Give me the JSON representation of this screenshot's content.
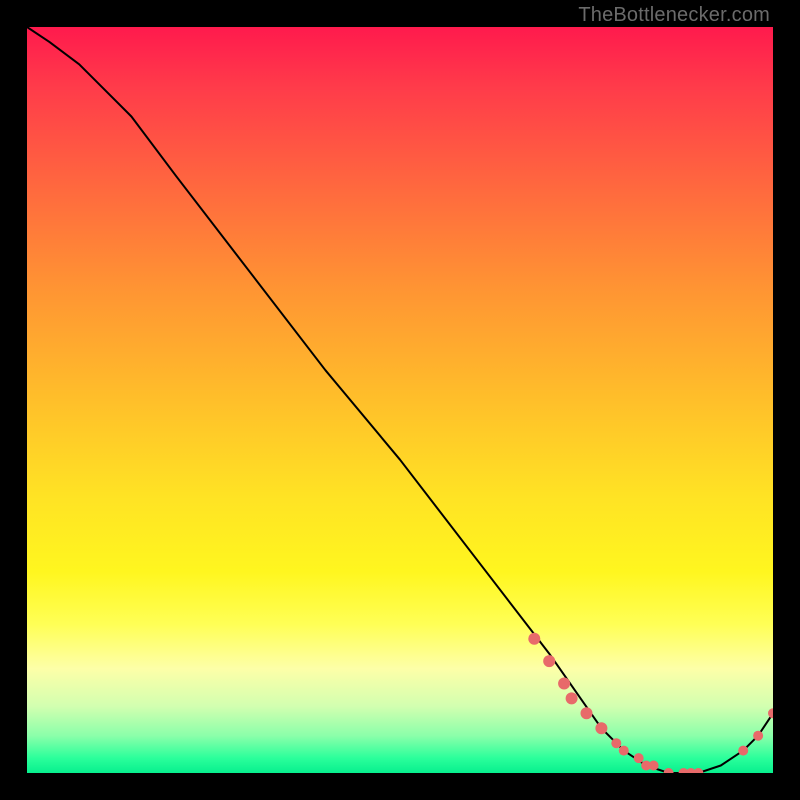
{
  "watermark": "TheBottlenecker.com",
  "colors": {
    "gradient_top": "#ff1a4d",
    "gradient_mid": "#ffe324",
    "gradient_bottom": "#07f08e",
    "curve": "#000000",
    "points": "#e86a6a",
    "page_bg": "#000000"
  },
  "chart_data": {
    "type": "line",
    "title": "",
    "xlabel": "",
    "ylabel": "",
    "xlim": [
      0,
      100
    ],
    "ylim": [
      0,
      100
    ],
    "grid": false,
    "legend": false,
    "curve": {
      "x": [
        0,
        3,
        7,
        10,
        14,
        20,
        30,
        40,
        50,
        60,
        70,
        77,
        80,
        83,
        86,
        90,
        93,
        96,
        98,
        100
      ],
      "y": [
        100,
        98,
        95,
        92,
        88,
        80,
        67,
        54,
        42,
        29,
        16,
        6,
        3,
        1,
        0,
        0,
        1,
        3,
        5,
        8
      ]
    },
    "points_thick_segment": {
      "description": "dense cluster of salmon points along the curve near x≈68–90",
      "x": [
        68,
        70,
        72,
        73,
        75,
        77,
        79,
        80,
        82,
        83,
        84,
        86,
        88,
        89,
        90
      ],
      "y": [
        18,
        15,
        12,
        10,
        8,
        6,
        4,
        3,
        2,
        1,
        1,
        0,
        0,
        0,
        0
      ]
    },
    "points_sparse": {
      "description": "few salmon points on the right upturn",
      "x": [
        96,
        98,
        100
      ],
      "y": [
        3,
        5,
        8
      ]
    }
  }
}
